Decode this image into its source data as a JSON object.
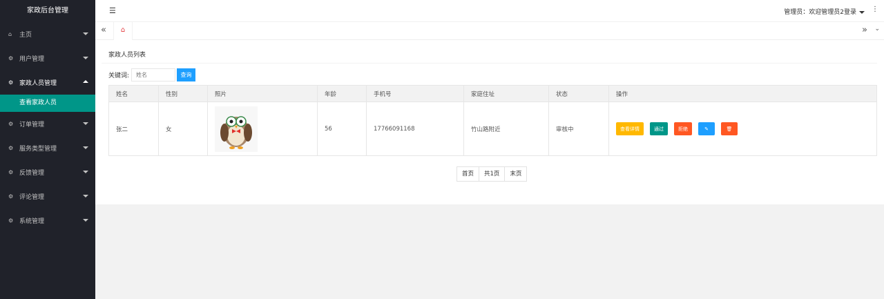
{
  "sidebar": {
    "title": "家政后台管理",
    "items": [
      {
        "label": "主页",
        "icon": "home-icon"
      },
      {
        "label": "用户管理",
        "icon": "gear-icon"
      },
      {
        "label": "家政人员管理",
        "icon": "gear-icon",
        "open": true,
        "sub": "查看家政人员"
      },
      {
        "label": "订单管理",
        "icon": "gear-icon"
      },
      {
        "label": "服务类型管理",
        "icon": "gear-icon"
      },
      {
        "label": "反馈管理",
        "icon": "gear-icon"
      },
      {
        "label": "评论管理",
        "icon": "gear-icon"
      },
      {
        "label": "系统管理",
        "icon": "gear-icon"
      }
    ]
  },
  "topbar": {
    "user_text": "管理员：欢迎管理员2登录"
  },
  "panel": {
    "title": "家政人员列表",
    "search_label": "关键词:",
    "search_placeholder": "姓名",
    "search_button": "查询"
  },
  "table": {
    "headers": [
      "姓名",
      "性别",
      "照片",
      "年龄",
      "手机号",
      "家庭住址",
      "状态",
      "操作"
    ],
    "rows": [
      {
        "name": "张二",
        "gender": "女",
        "age": "56",
        "phone": "17766091168",
        "address": "竹山路附近",
        "status": "审核中"
      }
    ],
    "actions": [
      {
        "label": "查看详情",
        "color": "#ffb800"
      },
      {
        "label": "通过",
        "color": "#009688"
      },
      {
        "label": "拒绝",
        "color": "#ff5722"
      },
      {
        "label": "✎",
        "color": "#1e9fff"
      },
      {
        "label": "🗑",
        "color": "#ff5722"
      }
    ]
  },
  "pager": {
    "first": "首页",
    "total": "共1页",
    "last": "末页"
  }
}
